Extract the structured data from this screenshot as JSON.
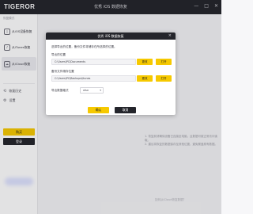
{
  "titlebar": {
    "logo": "TIGEROR",
    "title": "优秀 iOS 数据恢复",
    "controls": [
      "—",
      "□",
      "✕"
    ]
  },
  "sidebar": {
    "section_label": "恢复模式",
    "items": [
      {
        "label": "从iOS设备恢复",
        "icon": "phone-icon",
        "active": false
      },
      {
        "label": "从iTunes恢复",
        "icon": "itunes-icon",
        "active": false
      },
      {
        "label": "从iCloud恢复",
        "icon": "cloud-icon",
        "active": true
      }
    ],
    "links": [
      {
        "label": "恢复历史",
        "icon": "history-icon"
      },
      {
        "label": "设置",
        "icon": "gear-icon"
      }
    ],
    "buy_label": "购买",
    "login_label": "登录"
  },
  "background": {
    "notes": [
      "1. 恢复前请确保设备已连接至电脑，且数据可被正常访问读取。",
      "2. 建议将恢复的数据保存至其他位置，避免覆盖原有数据。"
    ],
    "link": "如何从iCloud恢复数据？"
  },
  "dialog": {
    "title": "优秀 iOS 数据恢复",
    "description": "选择导出的位置，备份文件将储存在所选择的位置。",
    "export_label": "导出的位置",
    "export_path": "C:\\Users\\PC\\Documents",
    "backup_label": "备份文件储存位置",
    "backup_path": "C:\\Users\\PC\\Backups\\itunes",
    "change_label": "更改",
    "open_label": "打开",
    "format_label": "导出数据格式",
    "format_value": "xlsx",
    "confirm_label": "确认",
    "cancel_label": "取消"
  },
  "colors": {
    "accent": "#f6c900",
    "dark": "#24252b"
  }
}
